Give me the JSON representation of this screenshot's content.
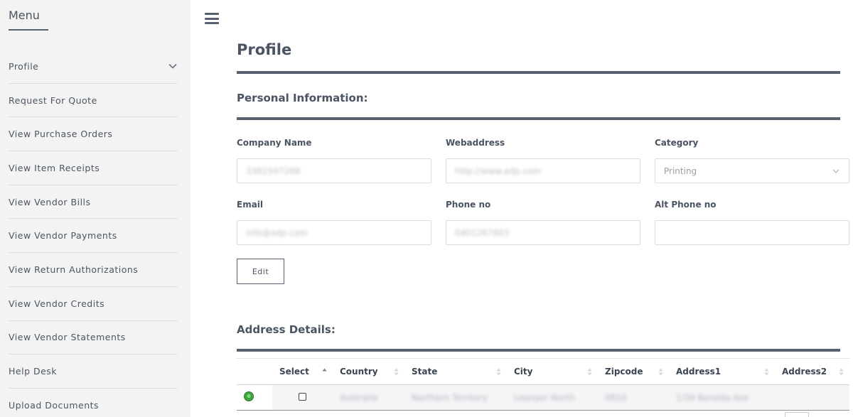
{
  "sidebar": {
    "title": "Menu",
    "items": [
      {
        "label": "Profile"
      },
      {
        "label": "Request For Quote"
      },
      {
        "label": "View Purchase Orders"
      },
      {
        "label": "View Item Receipts"
      },
      {
        "label": "View Vendor Bills"
      },
      {
        "label": "View Vendor Payments"
      },
      {
        "label": "View Return Authorizations"
      },
      {
        "label": "View Vendor Credits"
      },
      {
        "label": "View Vendor Statements"
      },
      {
        "label": "Help Desk"
      },
      {
        "label": "Upload Documents"
      }
    ]
  },
  "page": {
    "title": "Profile"
  },
  "personal": {
    "heading": "Personal Information:",
    "company_name": {
      "label": "Company Name",
      "value": "3382597268"
    },
    "webaddress": {
      "label": "Webaddress",
      "value": "http://www.adp.com"
    },
    "category": {
      "label": "Category",
      "value": "Printing"
    },
    "email": {
      "label": "Email",
      "value": "info@adp.com"
    },
    "phone": {
      "label": "Phone no",
      "value": "0401267803"
    },
    "alt_phone": {
      "label": "Alt Phone no",
      "value": ""
    },
    "edit_label": "Edit"
  },
  "address": {
    "heading": "Address Details:",
    "columns": [
      "Select",
      "Country",
      "State",
      "City",
      "Zipcode",
      "Address1",
      "Address2"
    ],
    "rows": [
      {
        "country": "Australia",
        "state": "Northern Territory",
        "city": "Leanyer North",
        "zipcode": "0810",
        "address1": "1/39 Beneda Ave",
        "address2": ""
      }
    ]
  },
  "colors": {
    "accent_rule": "#56606e",
    "sidebar_bg": "#f3f3f3",
    "row_selected": "#3fa33f"
  }
}
